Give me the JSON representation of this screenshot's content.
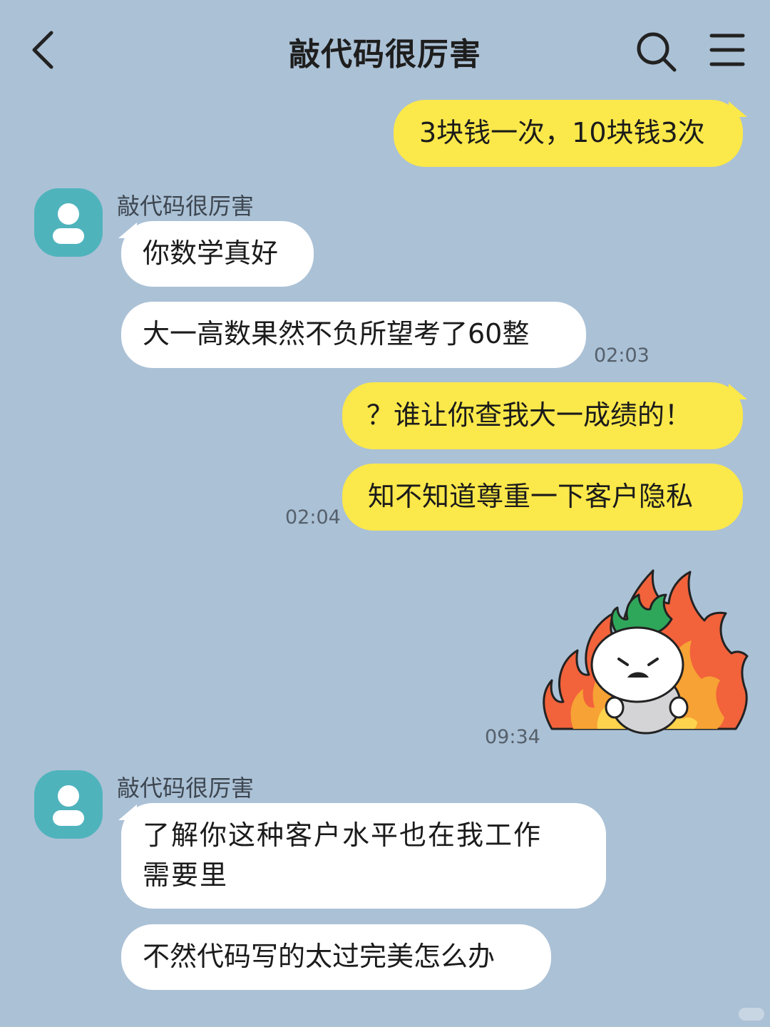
{
  "header": {
    "title": "敲代码很厉害",
    "back_icon": "chevron-left-icon",
    "search_icon": "search-icon",
    "menu_icon": "hamburger-menu-icon"
  },
  "messages": [
    {
      "id": 1,
      "direction": "outgoing",
      "text": "3块钱一次，10块钱3次"
    },
    {
      "id": 2,
      "direction": "incoming",
      "sender": "敲代码很厉害",
      "text": "你数学真好"
    },
    {
      "id": 3,
      "direction": "incoming",
      "text": "大一高数果然不负所望考了60整",
      "time": "02:03"
    },
    {
      "id": 4,
      "direction": "outgoing",
      "text": "？谁让你查我大一成绩的！"
    },
    {
      "id": 5,
      "direction": "outgoing",
      "text": "知不知道尊重一下客户隐私",
      "time": "02:04"
    },
    {
      "id": 6,
      "direction": "outgoing",
      "type": "sticker",
      "sticker": "angry-character-on-fire-sticker",
      "time": "09:34"
    },
    {
      "id": 7,
      "direction": "incoming",
      "sender": "敲代码很厉害",
      "lines": [
        "了解你这种客户水平也在我工作",
        "需要里"
      ]
    },
    {
      "id": 8,
      "direction": "incoming",
      "text": "不然代码写的太过完美怎么办"
    }
  ],
  "colors": {
    "background": "#abc1d6",
    "outgoing_bubble": "#fbe84a",
    "incoming_bubble": "#ffffff",
    "avatar": "#4fb3bc"
  }
}
